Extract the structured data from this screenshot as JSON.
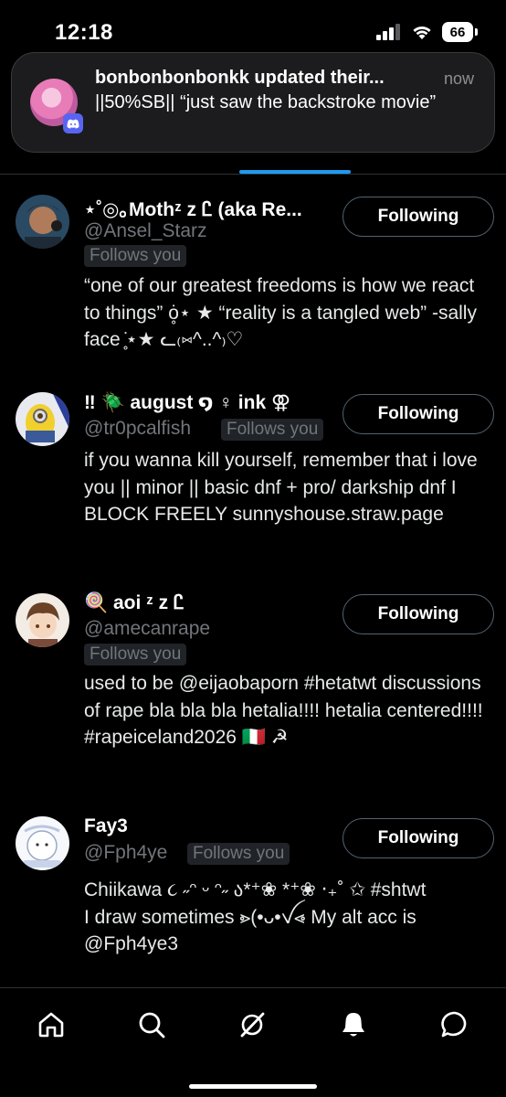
{
  "status_bar": {
    "time": "12:18",
    "battery": "66"
  },
  "notification": {
    "title": "bonbonbonbonkk updated their...",
    "time": "now",
    "body": "||50%SB|| “just saw the backstroke movie”"
  },
  "users": [
    {
      "name": "⋆˚◎｡Mothᶻ z Ꮭ (aka Re...",
      "handle": "@Ansel_Starz",
      "follows_you": "Follows you",
      "button": "Following",
      "bio": "“one of our greatest freedoms is how we react to things” ȯ̥⋆ ★ “reality is a tangled web” -sally face ̥̇⋆★ ᓚ₍⑅^..^₎♡"
    },
    {
      "name": "‼ 🪲 august ໑ ♀ ink ⚢",
      "handle": "@tr0pcalfish",
      "follows_you": "Follows you",
      "button": "Following",
      "bio": "if you wanna kill yourself, remember that i love you || minor || basic dnf + pro/ darkship dnf I BLOCK FREELY sunnyshouse.straw.page"
    },
    {
      "name": "🍭 aoi ᶻ z Ꮭ",
      "handle": "@amecanrape",
      "follows_you": "Follows you",
      "button": "Following",
      "bio": "used to be @eijaobaporn #hetatwt discussions of rape bla bla bla hetalia!!!! hetalia centered!!!! #rapeiceland2026 🇮🇹 ☭"
    },
    {
      "name": "Fay3",
      "handle": "@Fph4ye",
      "follows_you": "Follows you",
      "button": "Following",
      "bio": "Chiikawa ૮ ˶ᵔ ᵕ ᵔ˶ ა*⁺❀ *⁺❀ ‧₊˚ ✩ #shtwt\n I draw sometimes ⩺(•ᴗ•ꪜ⩹ My alt acc is @Fph4ye3"
    }
  ],
  "nav": [
    "home-icon",
    "search-icon",
    "grok-icon",
    "bell-icon",
    "message-icon"
  ],
  "colors": {
    "accent": "#1d9bf0",
    "background": "#000000",
    "muted": "#71767b"
  }
}
